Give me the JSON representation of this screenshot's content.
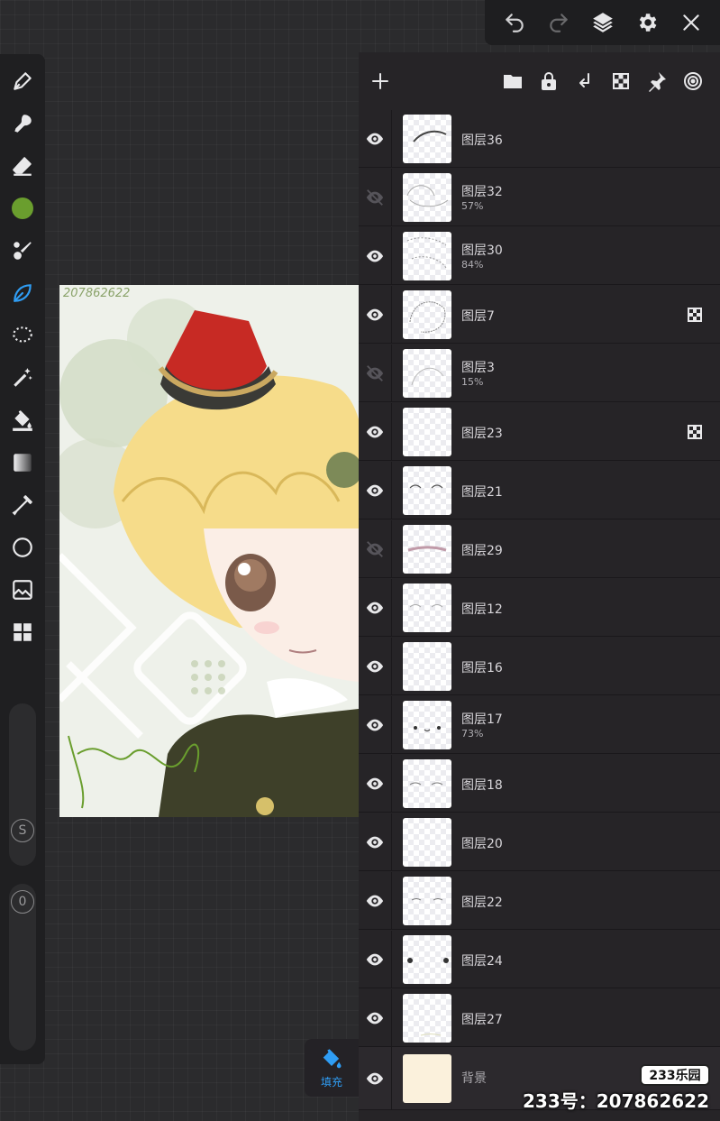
{
  "topbar": {
    "icons": [
      "undo-icon",
      "redo-icon",
      "layers-icon",
      "gear-icon",
      "close-icon"
    ]
  },
  "toolbar": {
    "tools": [
      "pen-icon",
      "smudge-icon",
      "eraser-icon",
      "color-swatch",
      "brush-icon",
      "lasso-leaf-icon",
      "selection-lasso-icon",
      "magic-wand-icon",
      "fill-bucket-icon",
      "gradient-icon",
      "eyedropper-icon",
      "shape-circle-icon",
      "image-icon",
      "grid-icon"
    ],
    "active_color": "#6a9e2e",
    "active_accent": "#2f9df4",
    "size_label": "S",
    "opacity_label": "0"
  },
  "artwork": {
    "number_text": "207862622"
  },
  "layer_panel": {
    "header_icons": [
      "add-icon",
      "folder-icon",
      "lock-icon",
      "merge-down-icon",
      "alpha-lock-icon",
      "pin-icon",
      "reference-icon"
    ],
    "layers": [
      {
        "name": "图层36",
        "opacity": "",
        "visible": true,
        "alpha_locked": false
      },
      {
        "name": "图层32",
        "opacity": "57%",
        "visible": false,
        "alpha_locked": false
      },
      {
        "name": "图层30",
        "opacity": "84%",
        "visible": true,
        "alpha_locked": false
      },
      {
        "name": "图层7",
        "opacity": "",
        "visible": true,
        "alpha_locked": true
      },
      {
        "name": "图层3",
        "opacity": "15%",
        "visible": false,
        "alpha_locked": false
      },
      {
        "name": "图层23",
        "opacity": "",
        "visible": true,
        "alpha_locked": true
      },
      {
        "name": "图层21",
        "opacity": "",
        "visible": true,
        "alpha_locked": false
      },
      {
        "name": "图层29",
        "opacity": "",
        "visible": false,
        "alpha_locked": false
      },
      {
        "name": "图层12",
        "opacity": "",
        "visible": true,
        "alpha_locked": false
      },
      {
        "name": "图层16",
        "opacity": "",
        "visible": true,
        "alpha_locked": false
      },
      {
        "name": "图层17",
        "opacity": "73%",
        "visible": true,
        "alpha_locked": false
      },
      {
        "name": "图层18",
        "opacity": "",
        "visible": true,
        "alpha_locked": false
      },
      {
        "name": "图层20",
        "opacity": "",
        "visible": true,
        "alpha_locked": false
      },
      {
        "name": "图层22",
        "opacity": "",
        "visible": true,
        "alpha_locked": false
      },
      {
        "name": "图层24",
        "opacity": "",
        "visible": true,
        "alpha_locked": false
      },
      {
        "name": "图层27",
        "opacity": "",
        "visible": true,
        "alpha_locked": false
      }
    ],
    "background_layer": {
      "name": "背景",
      "visible": true,
      "color": "#fbf1dc"
    }
  },
  "fill_button": {
    "label": "填充"
  },
  "watermark": {
    "badge": "233乐园",
    "id_text": "233号：207862622"
  }
}
